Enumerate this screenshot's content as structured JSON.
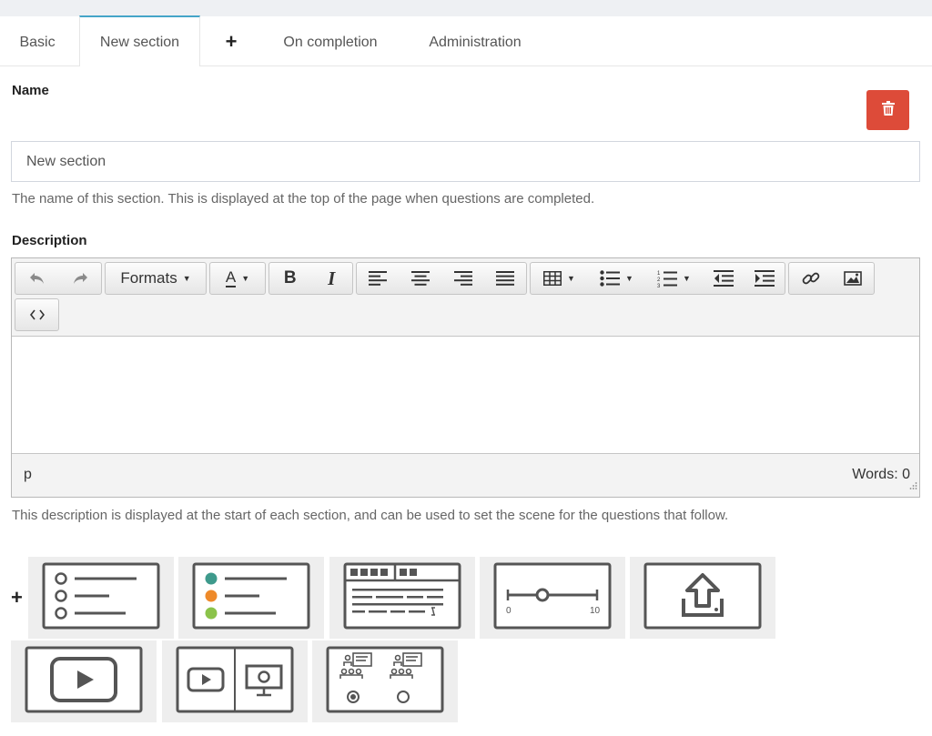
{
  "tabs": {
    "basic": "Basic",
    "new_section": "New section",
    "add": "+",
    "on_completion": "On completion",
    "administration": "Administration"
  },
  "name": {
    "label": "Name",
    "value": "New section",
    "help": "The name of this section. This is displayed at the top of the page when questions are completed."
  },
  "description": {
    "label": "Description",
    "help": "This description is displayed at the start of each section, and can be used to set the scene for the questions that follow."
  },
  "editor": {
    "formats_label": "Formats",
    "font_color_label": "A",
    "path": "p",
    "word_count": "Words: 0"
  },
  "question_types": {
    "add_label": "+",
    "slider_min": "0",
    "slider_max": "10"
  },
  "colors": {
    "accent": "#45a5c8",
    "danger": "#dd4b39",
    "dot_teal": "#3e9a8c",
    "dot_orange": "#ee8a2a",
    "dot_green": "#8bc34a"
  }
}
